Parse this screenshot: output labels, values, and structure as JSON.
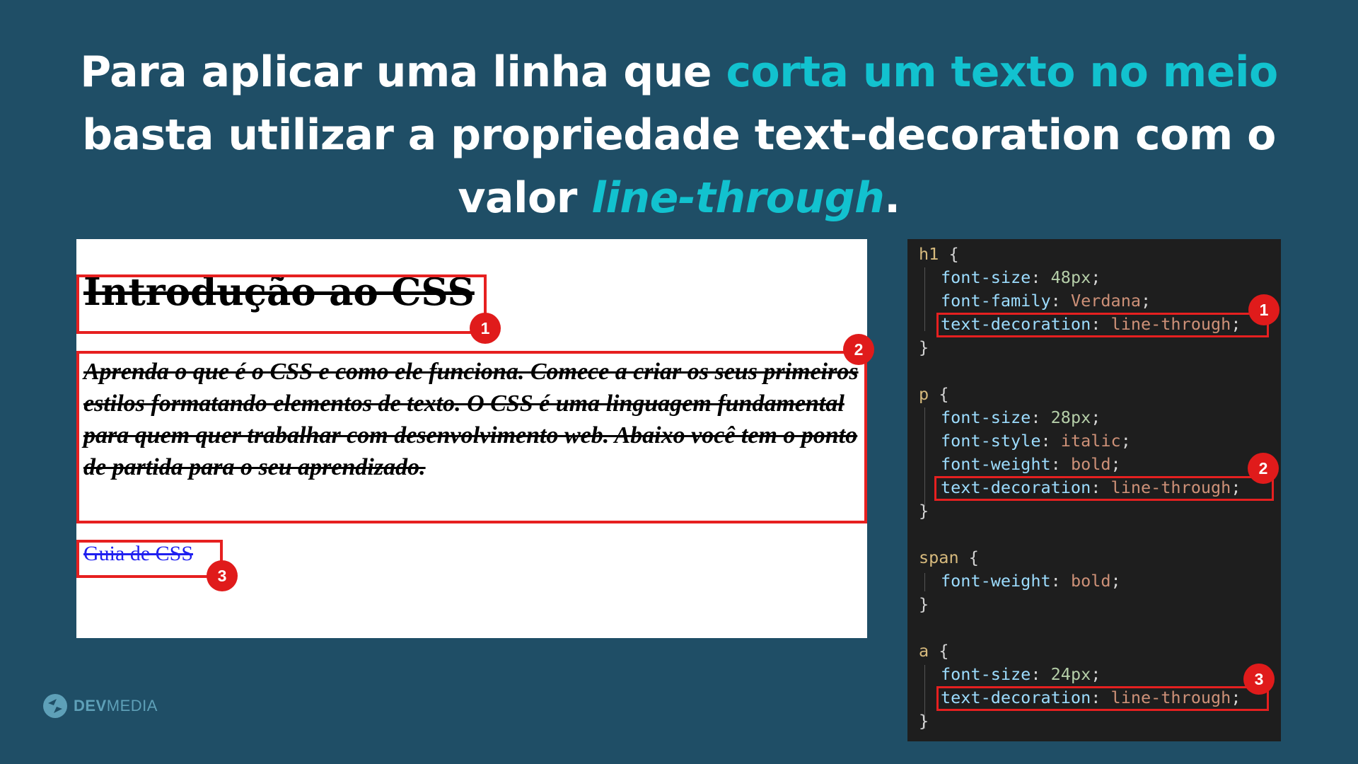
{
  "headline": {
    "p1": "Para aplicar uma linha que ",
    "hl1": "corta um texto no meio",
    "p2": " basta utilizar a propriedade text-decoration com o valor ",
    "hl2": "line-through",
    "p3": "."
  },
  "preview": {
    "h1": "Introdução ao CSS",
    "paragraph": "Aprenda o que é o CSS e como ele funciona. Comece a criar os seus primeiros estilos formatando elementos de texto. O CSS é uma linguagem fundamental para quem quer trabalhar com desenvolvimento web. Abaixo você tem o ponto de partida para o seu aprendizado.",
    "link": "Guia de CSS",
    "badges": [
      "1",
      "2",
      "3"
    ]
  },
  "code": {
    "h1_sel": "h1",
    "open": "{",
    "close": "}",
    "h1_fs_prop": "font-size",
    "h1_fs_val": "48px",
    "h1_ff_prop": "font-family",
    "h1_ff_val": "Verdana",
    "td_prop": "text-decoration",
    "td_val": "line-through",
    "p_sel": "p",
    "p_fs_prop": "font-size",
    "p_fs_val": "28px",
    "p_fst_prop": "font-style",
    "p_fst_val": "italic",
    "p_fw_prop": "font-weight",
    "p_fw_val": "bold",
    "span_sel": "span",
    "span_fw_prop": "font-weight",
    "span_fw_val": "bold",
    "a_sel": "a",
    "a_fs_prop": "font-size",
    "a_fs_val": "24px",
    "colon": ":",
    "semi": ";",
    "badges": [
      "1",
      "2",
      "3"
    ]
  },
  "logo": {
    "dev": "DEV",
    "media": "MEDIA"
  },
  "colors": {
    "background": "#1f4e66",
    "accent": "#12c2cf",
    "marker": "#e62020"
  }
}
